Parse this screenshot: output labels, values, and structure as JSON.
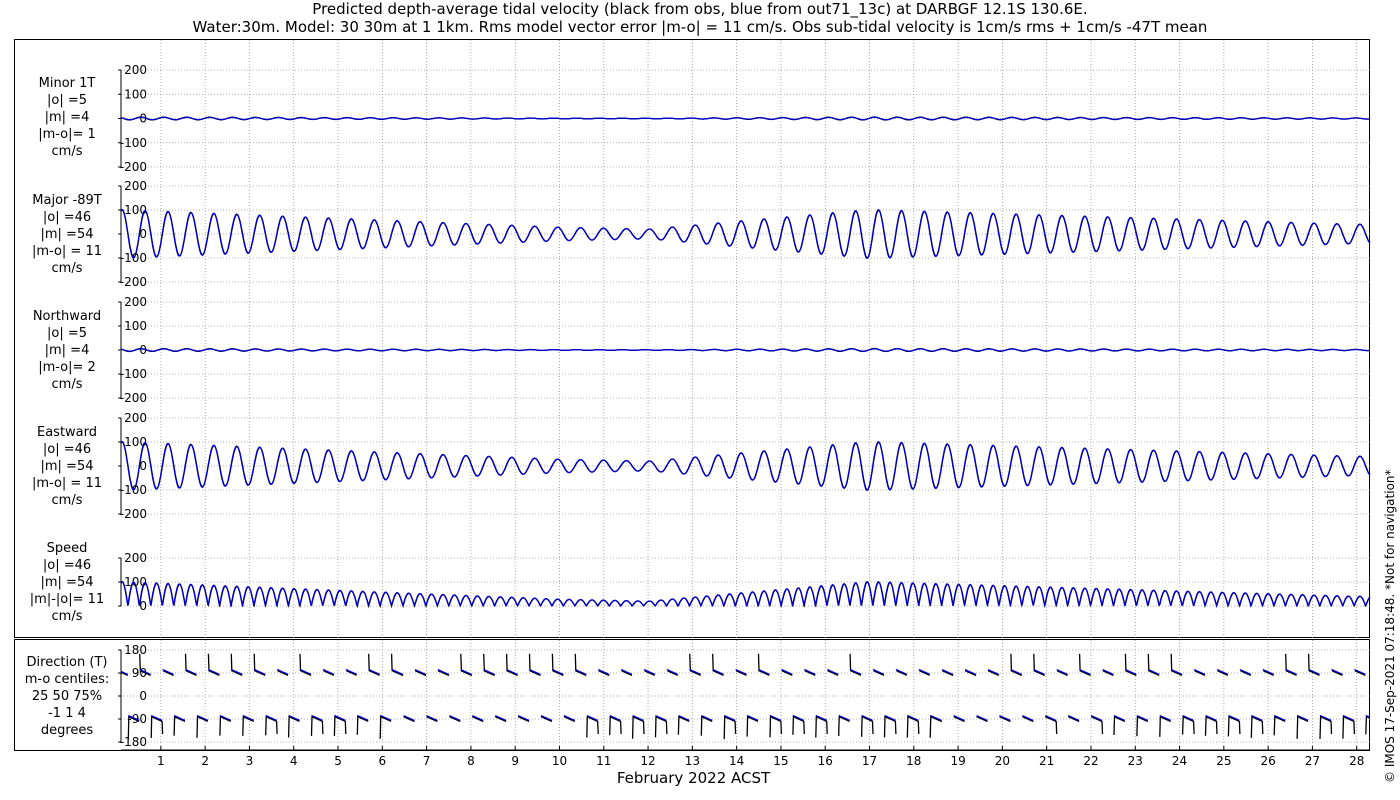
{
  "title_line1": "Predicted depth-average tidal velocity (black from obs, blue from out71_13c) at DARBGF 12.1S 130.6E.",
  "title_line2": "Water:30m. Model: 30 30m at 1 1km. Rms model vector error |m-o| = 11 cm/s. Obs sub-tidal velocity is 1cm/s rms + 1cm/s -47T mean",
  "copyright": "© IMOS 17-Sep-2021 07:18:48. *Not for navigation*",
  "colors": {
    "obs": "#000000",
    "model": "#0000d0",
    "grid": "#9a9a9a"
  },
  "chart_data": {
    "type": "line",
    "xlabel": "February 2022 ACST",
    "x_unit": "day of month",
    "xlim": [
      0.1,
      28.3
    ],
    "xticks": [
      1,
      2,
      3,
      4,
      5,
      6,
      7,
      8,
      9,
      10,
      11,
      12,
      13,
      14,
      15,
      16,
      17,
      18,
      19,
      20,
      21,
      22,
      23,
      24,
      25,
      26,
      27,
      28
    ],
    "grid": true,
    "series_styles": [
      {
        "key": "obs",
        "description": "black from obs",
        "color": "#000000"
      },
      {
        "key": "model",
        "description": "blue from out71_13c",
        "color": "#0000d0"
      }
    ],
    "panels": [
      {
        "id": "minor",
        "label_lines": [
          "Minor 1T",
          "|o| =5",
          "|m| =4",
          "|m-o|= 1",
          "cm/s"
        ],
        "ylim": [
          -200,
          200
        ],
        "yticks": [
          -200,
          -100,
          0,
          100,
          200
        ],
        "kind": "minor",
        "obs_amplitude_cm_s": 5,
        "model_amplitude_cm_s": 4
      },
      {
        "id": "major",
        "label_lines": [
          "Major -89T",
          "|o| =46",
          "|m| =54",
          "|m-o| = 11",
          "cm/s"
        ],
        "ylim": [
          -200,
          200
        ],
        "yticks": [
          -200,
          -100,
          0,
          100,
          200
        ],
        "kind": "major",
        "obs_amplitude_cm_s": 46,
        "model_amplitude_cm_s": 54
      },
      {
        "id": "northward",
        "label_lines": [
          "Northward",
          "|o| =5",
          "|m| =4",
          "|m-o|= 2",
          "cm/s"
        ],
        "ylim": [
          -200,
          200
        ],
        "yticks": [
          -200,
          -100,
          0,
          100,
          200
        ],
        "kind": "minor",
        "obs_amplitude_cm_s": 5,
        "model_amplitude_cm_s": 4
      },
      {
        "id": "eastward",
        "label_lines": [
          "Eastward",
          "|o| =46",
          "|m| =54",
          "|m-o| = 11",
          "cm/s"
        ],
        "ylim": [
          -200,
          200
        ],
        "yticks": [
          -200,
          -100,
          0,
          100,
          200
        ],
        "kind": "major",
        "obs_amplitude_cm_s": 46,
        "model_amplitude_cm_s": 54
      },
      {
        "id": "speed",
        "label_lines": [
          "Speed",
          "|o| =46",
          "|m| =54",
          "|m|-|o|= 11",
          "cm/s"
        ],
        "ylim": [
          0,
          200
        ],
        "yticks": [
          0,
          100,
          200
        ],
        "kind": "speed",
        "obs_amplitude_cm_s": 46,
        "model_amplitude_cm_s": 54
      },
      {
        "id": "direction",
        "label_lines": [
          "Direction (T)",
          "m-o centiles:",
          "25  50  75%",
          "-1  1  4",
          "degrees"
        ],
        "ylim": [
          -180,
          180
        ],
        "yticks": [
          -180,
          -90,
          0,
          90,
          180
        ],
        "kind": "direction",
        "centiles_percent": [
          25,
          50,
          75
        ],
        "centile_values_deg": [
          -1,
          1,
          4
        ]
      }
    ]
  }
}
